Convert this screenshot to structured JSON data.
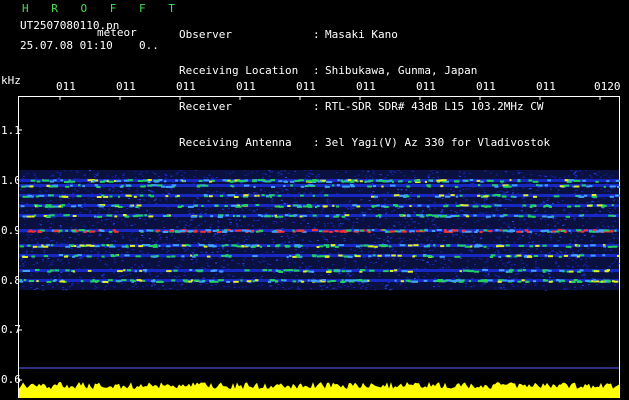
{
  "header": {
    "brand": "H R O F F T",
    "filename": "UT2507080110.pn",
    "filename_suffix": "meteor",
    "timestamp": "25.07.08 01:10",
    "status": "0..",
    "fields": [
      {
        "label": "Observer",
        "value": "Masaki Kano"
      },
      {
        "label": "Receiving Location",
        "value": "Shibukawa, Gunma, Japan"
      },
      {
        "label": "Receiver",
        "value": "RTL-SDR SDR# 43dB L15 103.2MHz CW"
      },
      {
        "label": "Receiving Antenna",
        "value": "3el Yagi(V) Az 330 for Vladivostok"
      }
    ]
  },
  "axis": {
    "y_unit": "kHz",
    "y_labels": [
      "1.1",
      "1.0",
      "0.9",
      "0.8",
      "0.7",
      "0.6"
    ],
    "x_labels": [
      "011",
      "011",
      "011",
      "011",
      "011",
      "011",
      "011",
      "011",
      "011",
      "0120"
    ]
  },
  "colors": {
    "background": "#000000",
    "noise": "#1a2bd0",
    "signal_mid": "#20d060",
    "signal_high": "#ff3030",
    "bottom_band": "#ffff00",
    "brand": "#3fe04a"
  },
  "chart_data": {
    "type": "heatmap",
    "y_unit": "kHz",
    "ylim": [
      0.6,
      1.14
    ],
    "bands_khz": [
      1.0,
      0.99,
      0.97,
      0.95,
      0.93,
      0.9,
      0.87,
      0.85,
      0.82,
      0.8
    ],
    "band_strength": [
      0.7,
      0.4,
      0.4,
      0.5,
      0.5,
      1.0,
      0.6,
      0.45,
      0.4,
      0.75
    ],
    "noise_band_khz": [
      0.78,
      1.02
    ],
    "x_labels": [
      "011",
      "011",
      "011",
      "011",
      "011",
      "011",
      "011",
      "011",
      "011",
      "0120"
    ]
  }
}
